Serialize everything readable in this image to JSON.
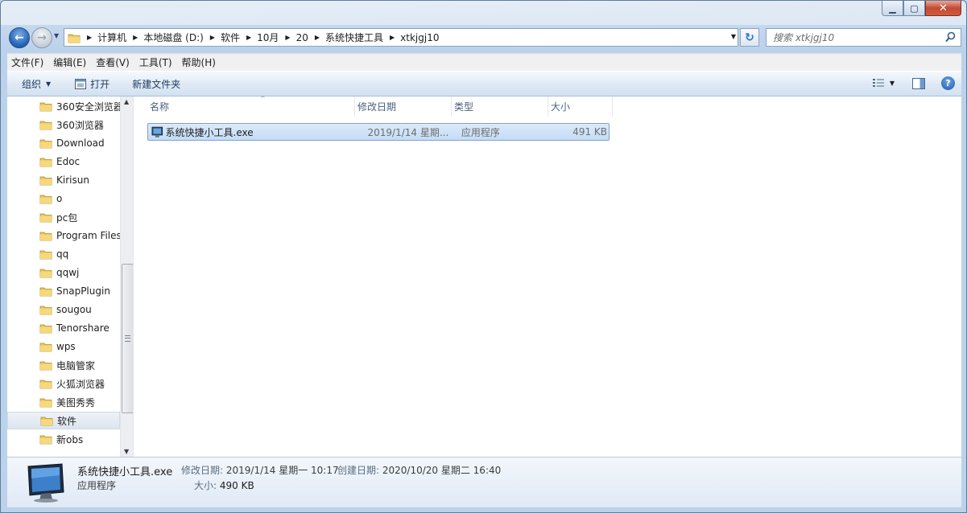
{
  "address": {
    "crumbs": [
      "计算机",
      "本地磁盘 (D:)",
      "软件",
      "10月",
      "20",
      "系统快捷工具",
      "xtkjgj10"
    ]
  },
  "search": {
    "placeholder": "搜索 xtkjgj10"
  },
  "menu": [
    "文件(F)",
    "编辑(E)",
    "查看(V)",
    "工具(T)",
    "帮助(H)"
  ],
  "toolbar": {
    "organize": "组织",
    "open": "打开",
    "new_folder": "新建文件夹"
  },
  "nav_tree": [
    "360安全浏览器",
    "360浏览器",
    "Download",
    "Edoc",
    "Kirisun",
    "o",
    "pc包",
    "Program Files",
    "qq",
    "qqwj",
    "SnapPlugin",
    "sougou",
    "Tenorshare",
    "wps",
    "电脑管家",
    "火狐浏览器",
    "美图秀秀",
    "软件",
    "新obs"
  ],
  "nav_selected": "软件",
  "columns": {
    "name": "名称",
    "modified": "修改日期",
    "type": "类型",
    "size": "大小"
  },
  "files": [
    {
      "name": "系统快捷小工具.exe",
      "modified": "2019/1/14 星期...",
      "type": "应用程序",
      "size": "491 KB"
    }
  ],
  "details": {
    "name": "系统快捷小工具.exe",
    "type": "应用程序",
    "modified_label": "修改日期:",
    "modified_value": "2019/1/14 星期一 10:17",
    "created_label": "创建日期:",
    "created_value": "2020/10/20 星期二 16:40",
    "size_label": "大小:",
    "size_value": "490 KB"
  },
  "colors": {
    "selection": "#cce4f7",
    "window_frame": "#b9d1ea",
    "accent": "#2b74c8"
  }
}
